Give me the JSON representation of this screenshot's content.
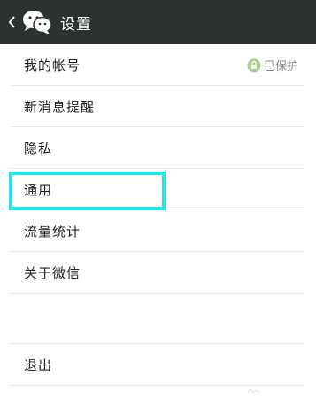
{
  "header": {
    "back_icon": "chevron-left-icon",
    "logo_icon": "wechat-logo-icon",
    "title": "设置"
  },
  "settings": {
    "items": [
      {
        "label": "我的帐号",
        "status": "已保护",
        "status_icon": "lock-icon"
      },
      {
        "label": "新消息提醒"
      },
      {
        "label": "隐私"
      },
      {
        "label": "通用"
      },
      {
        "label": "流量统计"
      },
      {
        "label": "关于微信"
      }
    ],
    "logout_label": "退出"
  },
  "annotation": {
    "highlight_color": "#27e4e4",
    "highlighted_item": "通用"
  },
  "colors": {
    "topbar_bg": "#2e3132",
    "accent_green": "#9fd28a"
  }
}
